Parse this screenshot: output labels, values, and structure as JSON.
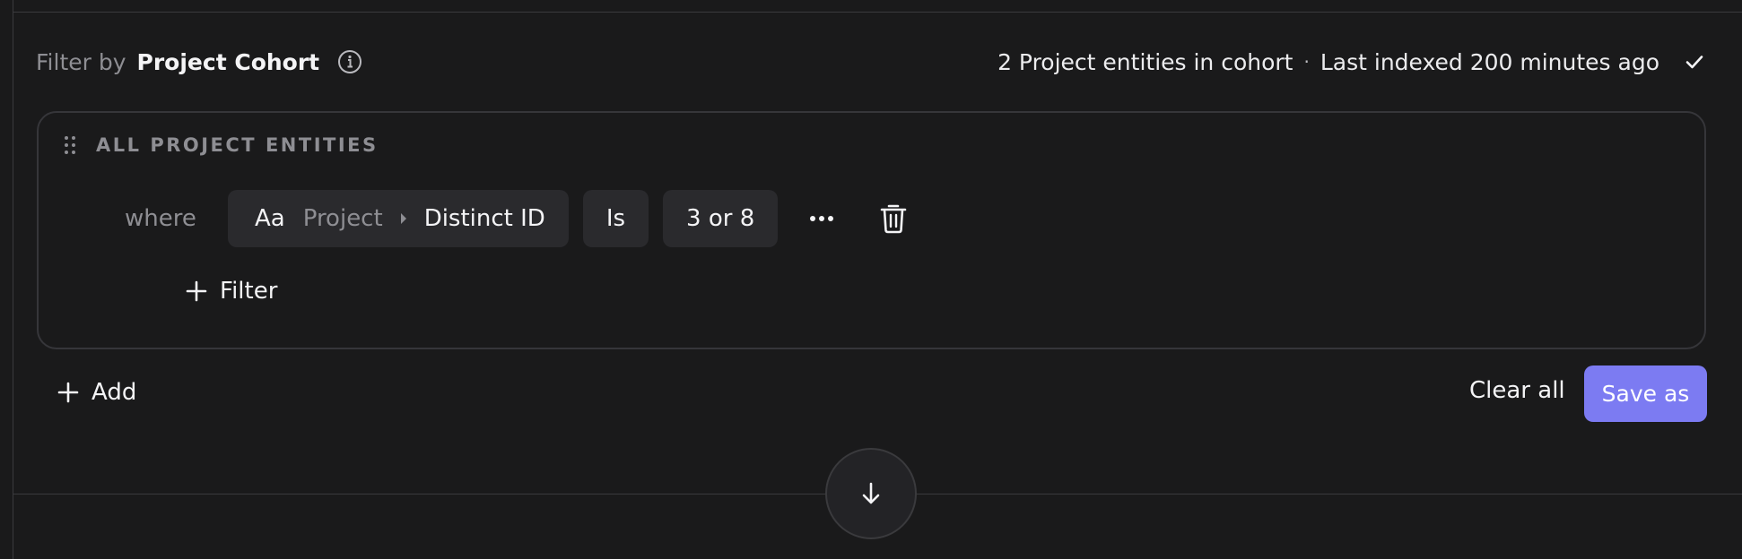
{
  "header": {
    "filter_by_label": "Filter by",
    "cohort_name": "Project Cohort",
    "entity_count_text": "2 Project entities in cohort",
    "separator": "·",
    "indexed_text": "Last indexed 200 minutes ago"
  },
  "group": {
    "title": "ALL PROJECT ENTITIES",
    "filter": {
      "where_label": "where",
      "property_type_icon": "Aa",
      "property_path_parent": "Project",
      "property_name": "Distinct ID",
      "operator": "Is",
      "value": "3 or 8"
    },
    "add_filter_label": "Filter"
  },
  "footer": {
    "add_label": "Add",
    "clear_all_label": "Clear all",
    "save_as_label": "Save as"
  },
  "colors": {
    "background": "#1a1a1b",
    "accent": "#7c7bf2",
    "muted_text": "#8e8e93",
    "pill_bg": "#2a2a2d"
  },
  "icons": {
    "info": "info-icon",
    "check": "check-icon",
    "drag": "drag-handle-icon",
    "caret": "caret-right-icon",
    "more": "more-icon",
    "trash": "trash-icon",
    "plus": "plus-icon",
    "arrow_down": "arrow-down-icon"
  }
}
